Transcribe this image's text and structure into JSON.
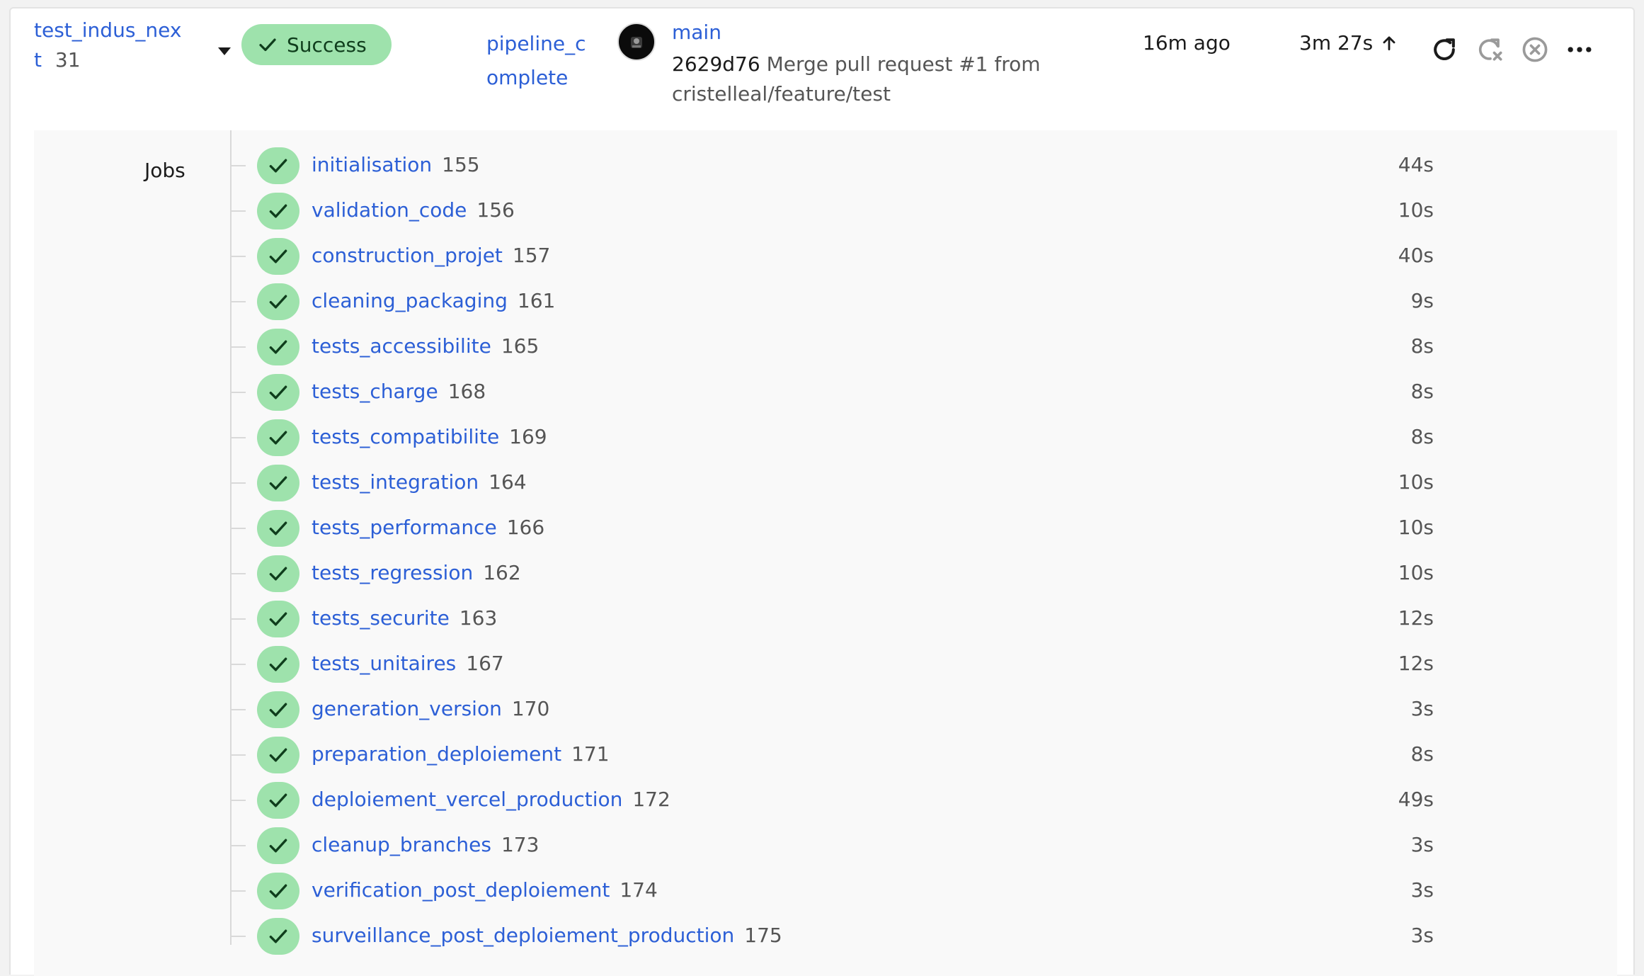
{
  "pipeline": {
    "name_line1": "test_indus_nex",
    "name_line2": "t",
    "number": "31",
    "status": "Success",
    "workflow_line1": "pipeline_c",
    "workflow_line2": "omplete",
    "branch": "main",
    "commit_hash": "2629d76",
    "commit_msg_line1": "Merge pull request #1 from",
    "commit_msg_line2": "cristelleal/feature/test",
    "started": "16m ago",
    "duration": "3m 27s"
  },
  "jobs_label": "Jobs",
  "jobs": [
    {
      "name": "initialisation",
      "id": "155",
      "duration": "44s"
    },
    {
      "name": "validation_code",
      "id": "156",
      "duration": "10s"
    },
    {
      "name": "construction_projet",
      "id": "157",
      "duration": "40s"
    },
    {
      "name": "cleaning_packaging",
      "id": "161",
      "duration": "9s"
    },
    {
      "name": "tests_accessibilite",
      "id": "165",
      "duration": "8s"
    },
    {
      "name": "tests_charge",
      "id": "168",
      "duration": "8s"
    },
    {
      "name": "tests_compatibilite",
      "id": "169",
      "duration": "8s"
    },
    {
      "name": "tests_integration",
      "id": "164",
      "duration": "10s"
    },
    {
      "name": "tests_performance",
      "id": "166",
      "duration": "10s"
    },
    {
      "name": "tests_regression",
      "id": "162",
      "duration": "10s"
    },
    {
      "name": "tests_securite",
      "id": "163",
      "duration": "12s"
    },
    {
      "name": "tests_unitaires",
      "id": "167",
      "duration": "12s"
    },
    {
      "name": "generation_version",
      "id": "170",
      "duration": "3s"
    },
    {
      "name": "preparation_deploiement",
      "id": "171",
      "duration": "8s"
    },
    {
      "name": "deploiement_vercel_production",
      "id": "172",
      "duration": "49s"
    },
    {
      "name": "cleanup_branches",
      "id": "173",
      "duration": "3s"
    },
    {
      "name": "verification_post_deploiement",
      "id": "174",
      "duration": "3s"
    },
    {
      "name": "surveillance_post_deploiement_production",
      "id": "175",
      "duration": "3s"
    }
  ],
  "icons": {
    "status": "check-icon",
    "rerun": "rerun-icon",
    "rerun_failed": "rerun-failed-icon",
    "cancel": "cancel-icon",
    "more": "more-icon",
    "duration_arrow": "arrow-up-icon"
  },
  "colors": {
    "success_bg": "#9ee2ac",
    "link": "#2c5fd6",
    "text": "#1b1b1b",
    "muted": "#555555"
  }
}
